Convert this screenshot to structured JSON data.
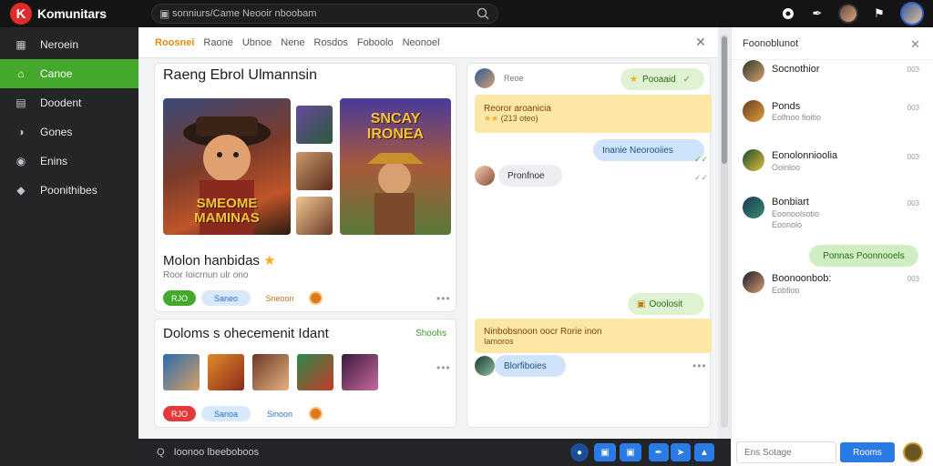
{
  "app": {
    "brand_letter": "K",
    "brand_name": "Komunitars"
  },
  "search": {
    "value": "sonniurs/Came Neooir nboobam"
  },
  "sidebar": {
    "items": [
      {
        "label": "Neroein",
        "icon": "grid-icon"
      },
      {
        "label": "Canoe",
        "icon": "home-icon",
        "active": true
      },
      {
        "label": "Doodent",
        "icon": "document-icon"
      },
      {
        "label": "Gones",
        "icon": "gamepad-icon"
      },
      {
        "label": "Enins",
        "icon": "bag-icon"
      },
      {
        "label": "Poonithibes",
        "icon": "tag-icon"
      }
    ]
  },
  "tabs": [
    {
      "label": "Roosnei",
      "active": true
    },
    {
      "label": "Raone"
    },
    {
      "label": "Ubnoe"
    },
    {
      "label": "Nene"
    },
    {
      "label": "Rosdos"
    },
    {
      "label": "Foboolo"
    },
    {
      "label": "Neonoel"
    }
  ],
  "card1": {
    "title": "Raeng Ebrol Ulmannsin",
    "art_text_1": "SMEOME MAMINAS",
    "art_text_2": "SNCAY IRONEA",
    "subtitle": "Molon hanbidas",
    "meta": "Roor Ioicrnun ulr ono",
    "pill_green": "RJO",
    "pill_blue": "Saneo",
    "pill_plain": "Sneoon"
  },
  "card2": {
    "title": "Doloms s ohecemenit Idant",
    "side": "Shoohs",
    "pill_red": "RJO",
    "pill_blue": "Sanoa",
    "pill_plain": "Sinoon"
  },
  "chat": {
    "avatar_label": "Reoe",
    "top_bubble": "Pooaaid",
    "yellow_title": "Reoror aroanicia",
    "yellow_sub": "(213 oteo)",
    "blue_bubble": "Inanie Neorooiies",
    "gray_bubble": "Pronfnoe",
    "green_bubble_2": "Ooolosit",
    "yellow2_title": "Ninbobsnoon oocr Rorie inon",
    "yellow2_sub": "Iamoros",
    "blue_bubble_2": "Blorfiboies"
  },
  "bottom": {
    "lead": "Q",
    "input_value": "Ioonoo lbeeboboos"
  },
  "right": {
    "title": "Foonoblunot",
    "contacts": [
      {
        "name": "Socnothior",
        "sub": "",
        "time": "003"
      },
      {
        "name": "Ponds",
        "sub": "Eolfnoo fioitio",
        "time": "003"
      },
      {
        "name": "Eonolonnioolia",
        "sub": "Ooinloo",
        "time": "003"
      },
      {
        "name": "Bonbiart",
        "sub": "Eoonoolsotio\nEoonolo",
        "time": "003"
      },
      {
        "name": "Boonoonbob:",
        "sub": "Eobfioo",
        "time": "003"
      }
    ],
    "bubble": "Ponnas Poonnooels",
    "input_placeholder": "Ens Sotage",
    "send_label": "Rooms"
  },
  "colors": {
    "accent": "#43a82b",
    "brand": "#e02b2b",
    "tab_active": "#e08b1a",
    "send": "#2b7be4"
  }
}
